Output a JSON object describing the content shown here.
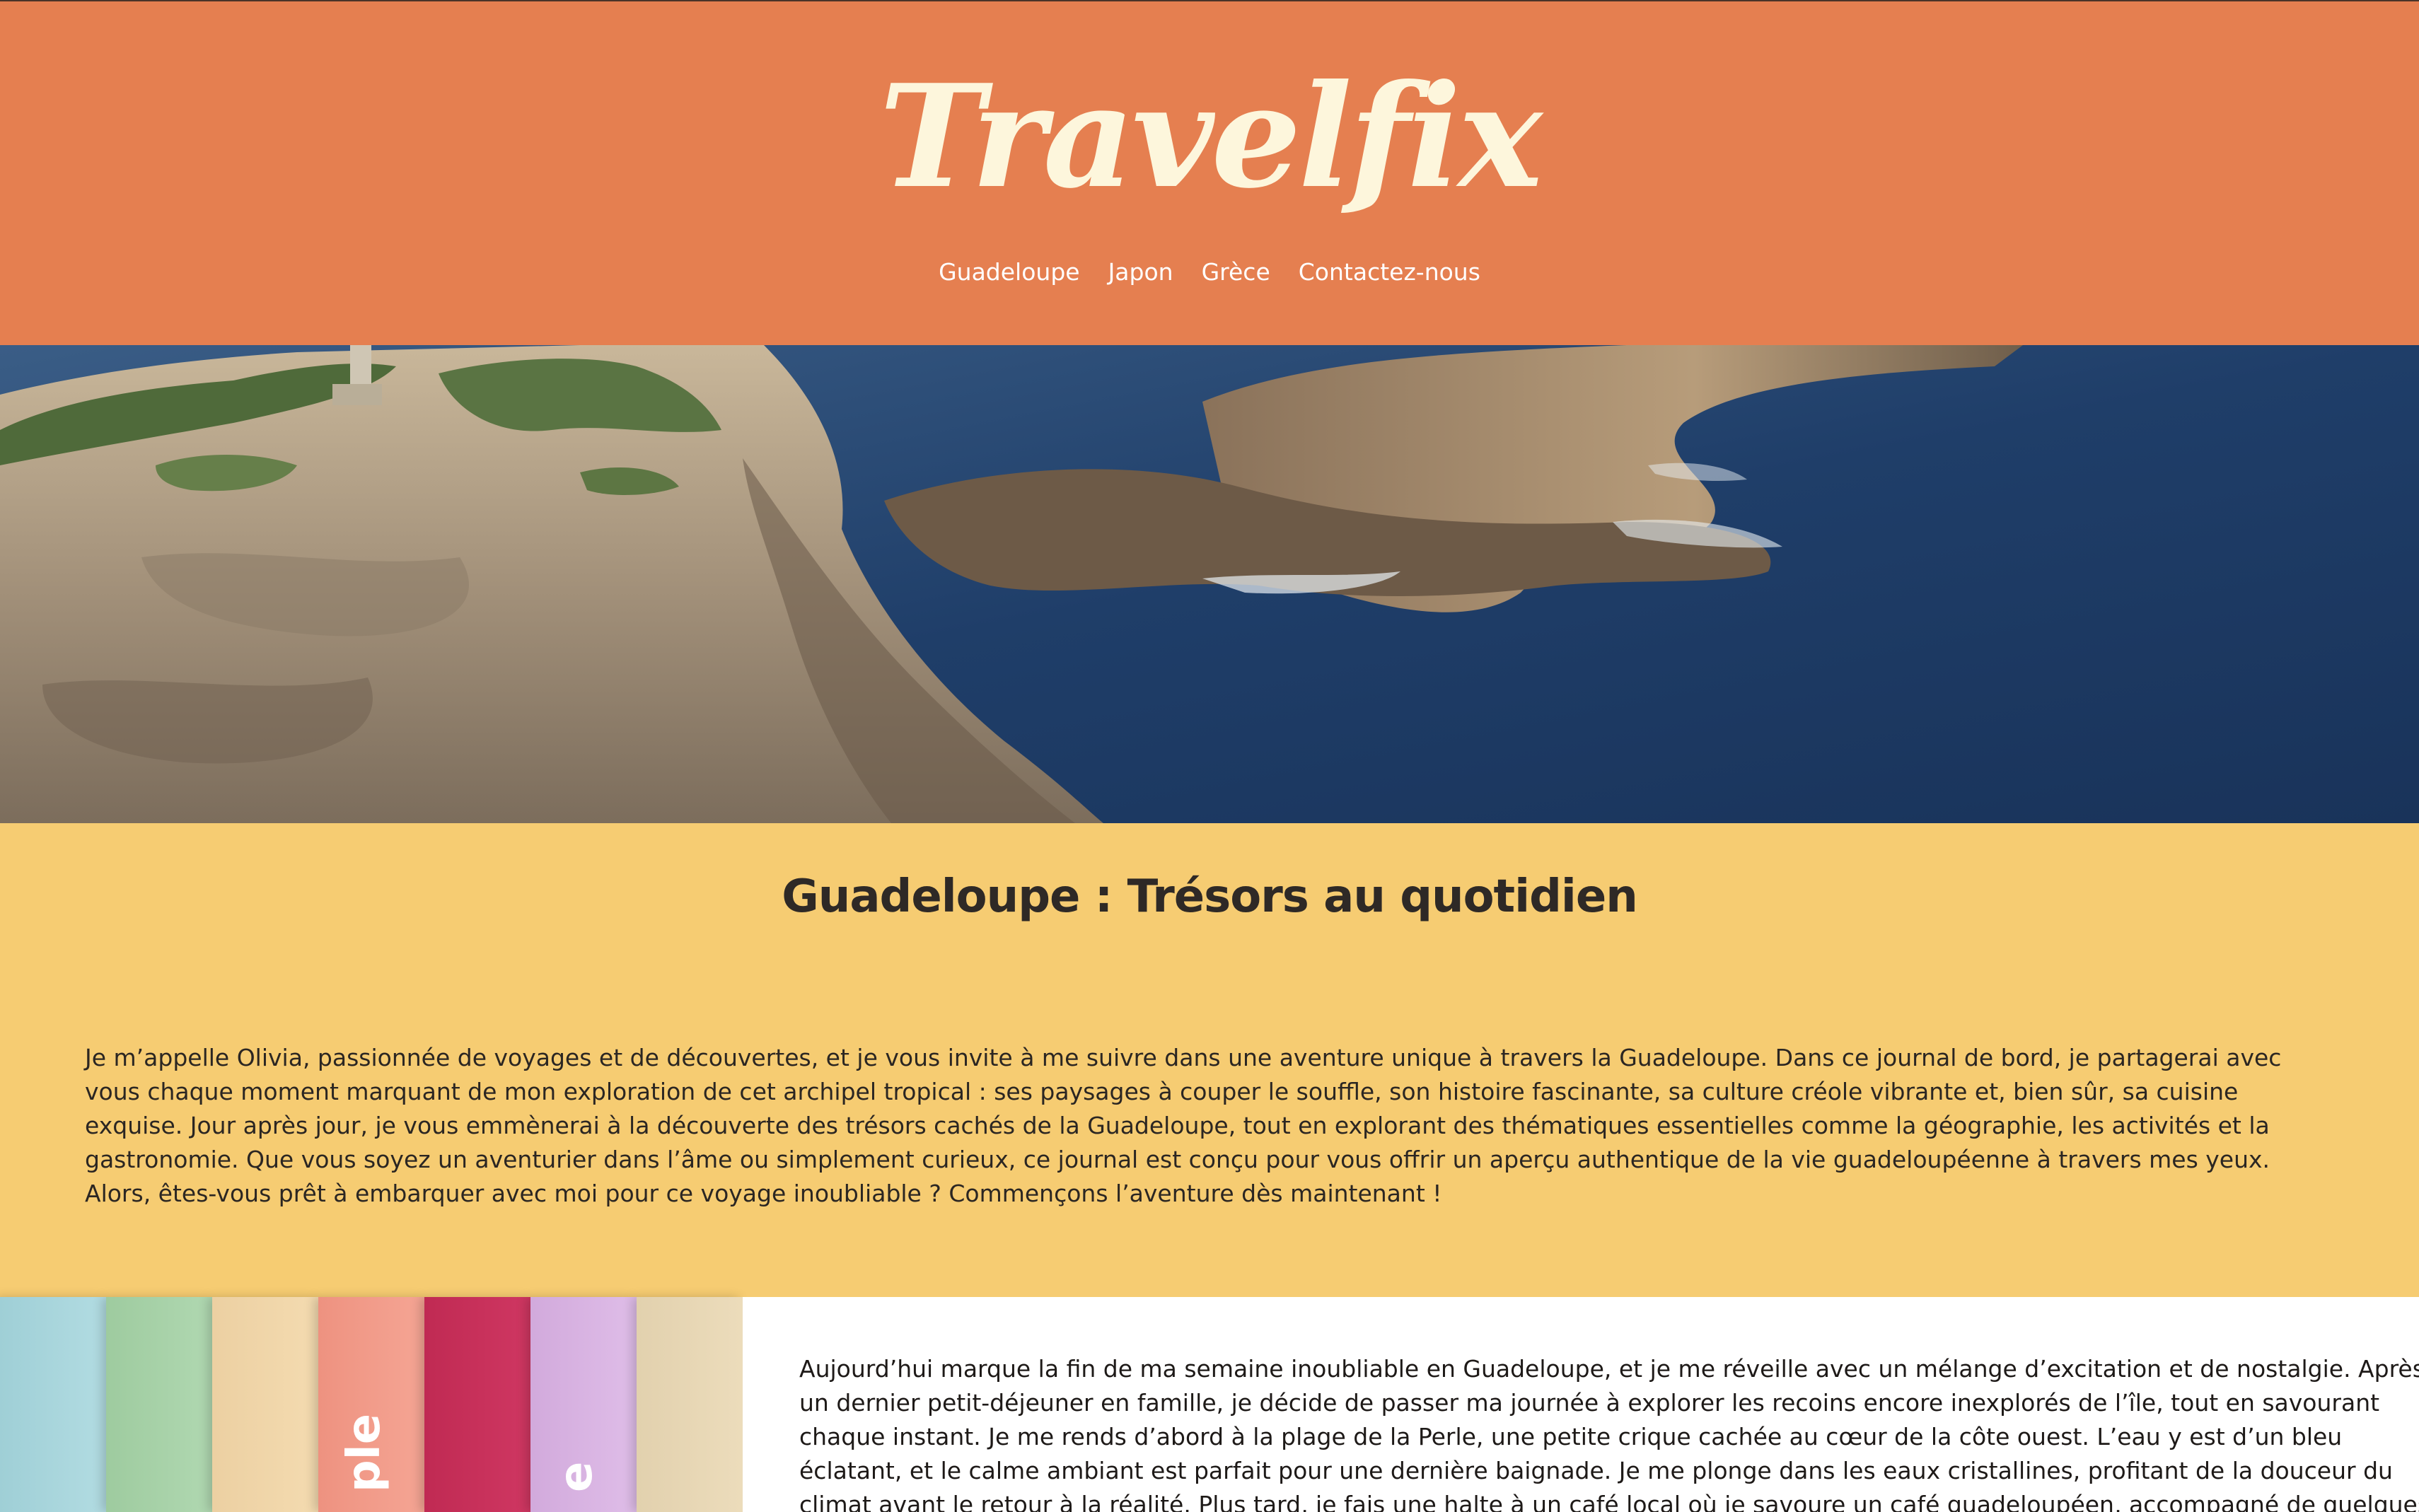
{
  "header": {
    "brand": "Travelfix",
    "nav": [
      {
        "label": "Guadeloupe"
      },
      {
        "label": "Japon"
      },
      {
        "label": "Grèce"
      },
      {
        "label": "Contactez-nous"
      }
    ],
    "bg_color": "#e57f50",
    "brand_color": "#fdf6dc"
  },
  "hero": {
    "subject": "aerial view of rocky coastline and deep blue sea"
  },
  "intro": {
    "title": "Guadeloupe : Trésors au quotidien",
    "text": "Je m’appelle Olivia, passionnée de voyages et de découvertes, et je vous invite à me suivre dans une aventure unique à travers la Guadeloupe. Dans ce journal de bord, je partagerai avec vous chaque moment marquant de mon exploration de cet archipel tropical : ses paysages à couper le souffle, son histoire fascinante, sa culture créole vibrante et, bien sûr, sa cuisine exquise. Jour après jour, je vous emmènerai à la découverte des trésors cachés de la Guadeloupe, tout en explorant des thématiques essentielles comme la géographie, les activités et la gastronomie. Que vous soyez un aventurier dans l’âme ou simplement curieux, ce journal est conçu pour vous offrir un aperçu authentique de la vie guadeloupéenne à travers mes yeux. Alors, êtes-vous prêt à embarquer avec moi pour ce voyage inoubliable ? Commençons l’aventure dès maintenant !",
    "bg_color": "#f6cc72"
  },
  "stripes": [
    {
      "color": "#a9d6dc",
      "label": ""
    },
    {
      "color": "#a7d2a8",
      "label": ""
    },
    {
      "color": "#f1d6aa",
      "label": ""
    },
    {
      "color": "#f29a88",
      "label": "ple"
    },
    {
      "color": "#c8305a",
      "label": ""
    },
    {
      "color": "#d8b4e2",
      "label": "e"
    },
    {
      "color": "#e6d6b4",
      "label": ""
    }
  ],
  "journal": {
    "text": "Aujourd’hui marque la fin de ma semaine inoubliable en Guadeloupe, et je me réveille avec un mélange d’excitation et de nostalgie. Après un dernier petit-déjeuner en famille, je décide de passer ma journée à explorer les recoins encore inexplorés de l’île, tout en savourant chaque instant. Je me rends d’abord à la plage de la Perle, une petite crique cachée au cœur de la côte ouest. L’eau y est d’un bleu éclatant, et le calme ambiant est parfait pour une dernière baignade. Je me plonge dans les eaux cristallines, profitant de la douceur du climat avant le retour à la réalité. Plus tard, je fais une halte à un café local où je savoure un café guadeloupéen, accompagné de quelques pâtisseries"
  }
}
